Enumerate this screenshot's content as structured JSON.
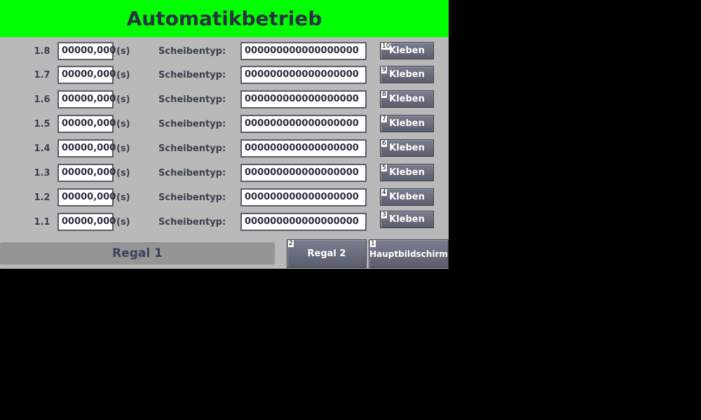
{
  "header": {
    "title": "Automatikbetrieb"
  },
  "rows": [
    {
      "pos": "1.8",
      "time": "00000,000",
      "unit": "(s)",
      "type_label": "Scheibentyp:",
      "type_value": "000000000000000000",
      "button_label": "Kleben",
      "hotkey": "10"
    },
    {
      "pos": "1.7",
      "time": "00000,000",
      "unit": "(s)",
      "type_label": "Scheibentyp:",
      "type_value": "000000000000000000",
      "button_label": "Kleben",
      "hotkey": "9"
    },
    {
      "pos": "1.6",
      "time": "00000,000",
      "unit": "(s)",
      "type_label": "Scheibentyp:",
      "type_value": "000000000000000000",
      "button_label": "Kleben",
      "hotkey": "8"
    },
    {
      "pos": "1.5",
      "time": "00000,000",
      "unit": "(s)",
      "type_label": "Scheibentyp:",
      "type_value": "000000000000000000",
      "button_label": "Kleben",
      "hotkey": "7"
    },
    {
      "pos": "1.4",
      "time": "00000,000",
      "unit": "(s)",
      "type_label": "Scheibentyp:",
      "type_value": "000000000000000000",
      "button_label": "Kleben",
      "hotkey": "6"
    },
    {
      "pos": "1.3",
      "time": "00000,000",
      "unit": "(s)",
      "type_label": "Scheibentyp:",
      "type_value": "000000000000000000",
      "button_label": "Kleben",
      "hotkey": "5"
    },
    {
      "pos": "1.2",
      "time": "00000,000",
      "unit": "(s)",
      "type_label": "Scheibentyp:",
      "type_value": "000000000000000000",
      "button_label": "Kleben",
      "hotkey": "4"
    },
    {
      "pos": "1.1",
      "time": "00000,000",
      "unit": "(s)",
      "type_label": "Scheibentyp:",
      "type_value": "000000000000000000",
      "button_label": "Kleben",
      "hotkey": "3"
    }
  ],
  "footer": {
    "current_label": "Regal 1",
    "regal2_label": "Regal 2",
    "regal2_hotkey": "2",
    "main_label": "Hauptbildschirm",
    "main_hotkey": "1"
  },
  "colors": {
    "header_bg": "#00ff00",
    "panel_bg": "#b9b9b9",
    "button_bg": "#6a6d7c"
  }
}
